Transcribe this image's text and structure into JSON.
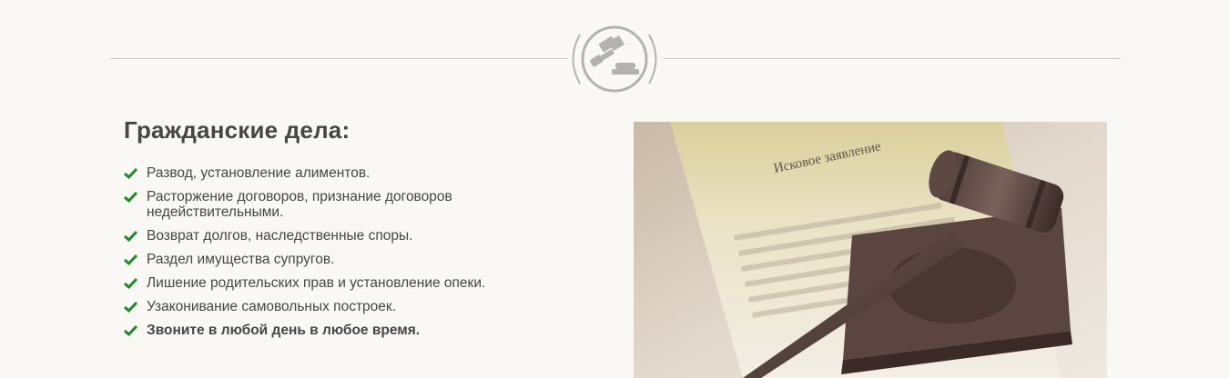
{
  "header": {
    "emblem_icon": "gavel-icon"
  },
  "section": {
    "title": "Гражданские дела:",
    "items": [
      "Развод, установление алиментов.",
      "Расторжение договоров, признание договоров недействительными.",
      "Возврат долгов, наследственные споры.",
      "Раздел имущества супругов.",
      "Лишение родительских прав и установление опеки.",
      "Узаконивание самовольных построек.",
      "Звоните в любой день в любое время."
    ],
    "check_icon": "checkmark-icon",
    "check_color": "#1e8a2c"
  },
  "photo": {
    "document_heading": "Исковое заявление"
  },
  "colors": {
    "background": "#f9f8f4",
    "text": "#454545",
    "divider": "#c9c7c1",
    "emblem": "#b4b2ad"
  }
}
